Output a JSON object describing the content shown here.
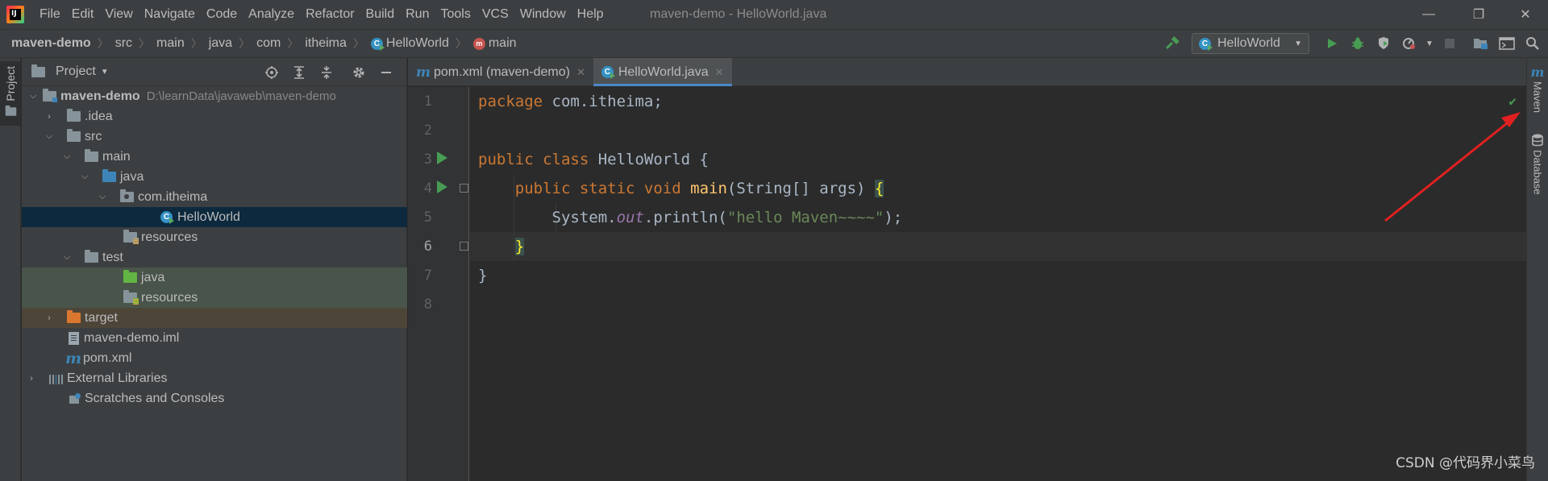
{
  "menubar": {
    "items": [
      "File",
      "Edit",
      "View",
      "Navigate",
      "Code",
      "Analyze",
      "Refactor",
      "Build",
      "Run",
      "Tools",
      "VCS",
      "Window",
      "Help"
    ],
    "window_title": "maven-demo - HelloWorld.java",
    "logo_text": "IJ"
  },
  "window_controls": {
    "minimize": "—",
    "restore": "❐",
    "close": "✕"
  },
  "breadcrumb": [
    "maven-demo",
    "src",
    "main",
    "java",
    "com",
    "itheima",
    "HelloWorld",
    "main"
  ],
  "toolbar": {
    "run_config": "HelloWorld",
    "icons": [
      "hammer-icon",
      "run-icon",
      "debug-icon",
      "coverage-icon",
      "profile-icon",
      "stop-icon",
      "project-structure-icon",
      "terminal-icon",
      "search-icon"
    ]
  },
  "left_stripe": {
    "project_tab": "Project"
  },
  "project_panel": {
    "title": "Project",
    "tree": [
      {
        "label": "maven-demo",
        "path": "D:\\learnData\\javaweb\\maven-demo",
        "depth": 0,
        "expanded": true,
        "icon": "module-folder-icon"
      },
      {
        "label": ".idea",
        "depth": 1,
        "expanded": false,
        "icon": "folder-icon"
      },
      {
        "label": "src",
        "depth": 1,
        "expanded": true,
        "icon": "folder-icon"
      },
      {
        "label": "main",
        "depth": 2,
        "expanded": true,
        "icon": "folder-icon"
      },
      {
        "label": "java",
        "depth": 3,
        "expanded": true,
        "icon": "source-folder-icon"
      },
      {
        "label": "com.itheima",
        "depth": 4,
        "expanded": true,
        "icon": "package-icon"
      },
      {
        "label": "HelloWorld",
        "depth": 5,
        "icon": "java-class-icon",
        "selected": true
      },
      {
        "label": "resources",
        "depth": 4,
        "icon": "resources-folder-icon"
      },
      {
        "label": "test",
        "depth": 2,
        "expanded": true,
        "icon": "folder-icon"
      },
      {
        "label": "java",
        "depth": 3,
        "icon": "test-source-folder-icon"
      },
      {
        "label": "resources",
        "depth": 3,
        "icon": "test-resources-folder-icon"
      },
      {
        "label": "target",
        "depth": 1,
        "expanded": false,
        "icon": "excluded-folder-icon"
      },
      {
        "label": "maven-demo.iml",
        "depth": 1,
        "icon": "iml-file-icon"
      },
      {
        "label": "pom.xml",
        "depth": 1,
        "icon": "maven-file-icon"
      },
      {
        "label": "External Libraries",
        "depth": 0,
        "expanded": false,
        "icon": "libraries-icon"
      },
      {
        "label": "Scratches and Consoles",
        "depth": 0,
        "icon": "scratches-icon"
      }
    ]
  },
  "editor": {
    "tabs": [
      {
        "label": "pom.xml (maven-demo)",
        "active": false
      },
      {
        "label": "HelloWorld.java",
        "active": true
      }
    ],
    "line_numbers": [
      "1",
      "2",
      "3",
      "4",
      "5",
      "6",
      "7",
      "8"
    ],
    "code": {
      "l1_kw": "package",
      "l1_rest": " com.itheima;",
      "l3_kw": "public class",
      "l3_rest": " HelloWorld {",
      "l4_kw": "public static void",
      "l4_fn": "main",
      "l4_rest": "(String[] args) ",
      "l4_brace": "{",
      "l5_a": "System.",
      "l5_field": "out",
      "l5_b": ".println(",
      "l5_str": "\"hello Maven~~~~\"",
      "l5_c": ");",
      "l6_brace": "}",
      "l7": "}"
    }
  },
  "right_stripe": {
    "maven_tab": "Maven",
    "database_tab": "Database",
    "maven_glyph": "m"
  },
  "watermark": "CSDN @代码界小菜鸟",
  "colors": {
    "annotation_arrow": "#e02020",
    "accent": "#4a88c7"
  }
}
